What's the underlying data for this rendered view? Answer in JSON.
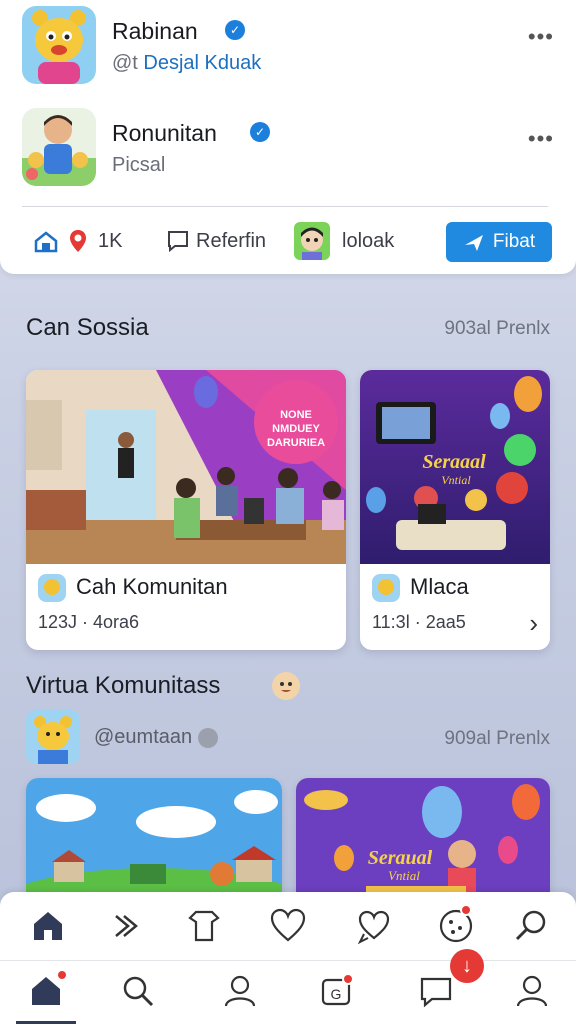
{
  "profiles": [
    {
      "name": "Rabinan",
      "handle_prefix": "@t",
      "handle_accent": "Desjal Kduak",
      "more": "•••"
    },
    {
      "name": "Ronunitan",
      "handle_prefix": "Picsal",
      "handle_accent": "",
      "more": "•••"
    }
  ],
  "actions": {
    "count": "1K",
    "referral": "Referfin",
    "user": "loloak",
    "primary": "Fibat"
  },
  "section1": {
    "title": "Can Sossia",
    "meta": "903al Prenlx",
    "cards": [
      {
        "title": "Cah Komunitan",
        "sub": "123J · 4ora6",
        "badge": "NONE NMDUEY DARURIEA"
      },
      {
        "title": "Mlaca",
        "sub": "11:3l · 2aa5",
        "badge": "Seraaal Vntial",
        "chev": "›"
      }
    ]
  },
  "section2": {
    "title": "Virtua Komunitass",
    "user": "@eumtaan",
    "meta": "909al Prenlx",
    "cards": [
      {
        "label": ""
      },
      {
        "badge": "Seraual Vntial"
      }
    ]
  },
  "colors": {
    "accent": "#1f8ae0",
    "notify": "#e53935",
    "verified": "#1d7fdc"
  },
  "nav1_icons": [
    "home-icon",
    "forward-icon",
    "shirt-icon",
    "heart-icon",
    "chat-heart-icon",
    "cookie-icon",
    "search-icon"
  ],
  "nav2_icons": [
    "home-icon",
    "search-icon",
    "profile-icon",
    "gift-icon",
    "message-icon",
    "account-icon"
  ]
}
